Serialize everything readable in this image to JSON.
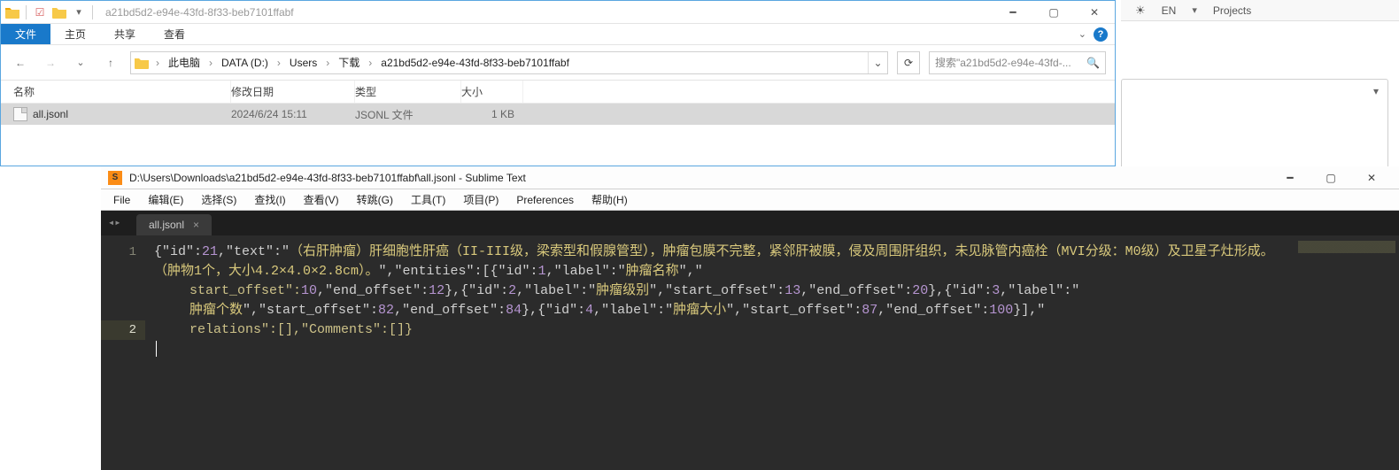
{
  "top_right": {
    "lang": "EN",
    "projects": "Projects"
  },
  "explorer": {
    "title": "a21bd5d2-e94e-43fd-8f33-beb7101ffabf",
    "tabs": {
      "file": "文件",
      "home": "主页",
      "share": "共享",
      "view": "查看"
    },
    "breadcrumb": {
      "this_pc": "此电脑",
      "drive": "DATA (D:)",
      "users": "Users",
      "downloads": "下载",
      "folder": "a21bd5d2-e94e-43fd-8f33-beb7101ffabf"
    },
    "search_placeholder": "搜索\"a21bd5d2-e94e-43fd-...",
    "columns": {
      "name": "名称",
      "modified": "修改日期",
      "type": "类型",
      "size": "大小"
    },
    "file": {
      "name": "all.jsonl",
      "modified": "2024/6/24 15:11",
      "type": "JSONL 文件",
      "size": "1 KB"
    }
  },
  "sublime": {
    "title": "D:\\Users\\Downloads\\a21bd5d2-e94e-43fd-8f33-beb7101ffabf\\all.jsonl - Sublime Text",
    "menu": {
      "file": "File",
      "edit": "编辑(E)",
      "select": "选择(S)",
      "find": "查找(I)",
      "view": "查看(V)",
      "goto": "转跳(G)",
      "tools": "工具(T)",
      "project": "项目(P)",
      "prefs": "Preferences",
      "help": "帮助(H)"
    },
    "tab": "all.jsonl",
    "line_numbers": {
      "l1": "1",
      "l2": "2"
    },
    "code": {
      "pre_id": "{\"id\":",
      "id_val": "21",
      "text_key": ",\"text\":\"",
      "text_body": "（右肝肿瘤）肝细胞性肝癌（II-III级，梁索型和假腺管型），肿瘤包膜不完整，紧邻肝被膜，侵及周围肝组织，未见脉管内癌栓（MVI分级：M0级）及卫星子灶形成。（肿物1个，大小4.2×4.0×2.8cm）。",
      "entities_key": "\",\"entities\":[{\"id\":",
      "e1_id": "1",
      "label_k": ",\"label\":\"",
      "e1_label": "肿瘤名称",
      "so_k": "\",\"",
      "start_k": "start_offset\":",
      "e1_so": "10",
      "eo_k": ",\"end_offset\":",
      "e1_eo": "12",
      "next": "},{\"id\":",
      "e2_id": "2",
      "e2_label": "肿瘤级别",
      "e2_so": "13",
      "e2_eo": "20",
      "e3_id": "3",
      "e3_label": "肿瘤个数",
      "e3_so": "82",
      "e3_eo": "84",
      "e4_id": "4",
      "e4_label": "肿瘤大小",
      "e4_so": "87",
      "e4_eo": "100",
      "tail": "}],\"",
      "relations_k": "relations\":[],\"Comments\":[]}"
    }
  }
}
